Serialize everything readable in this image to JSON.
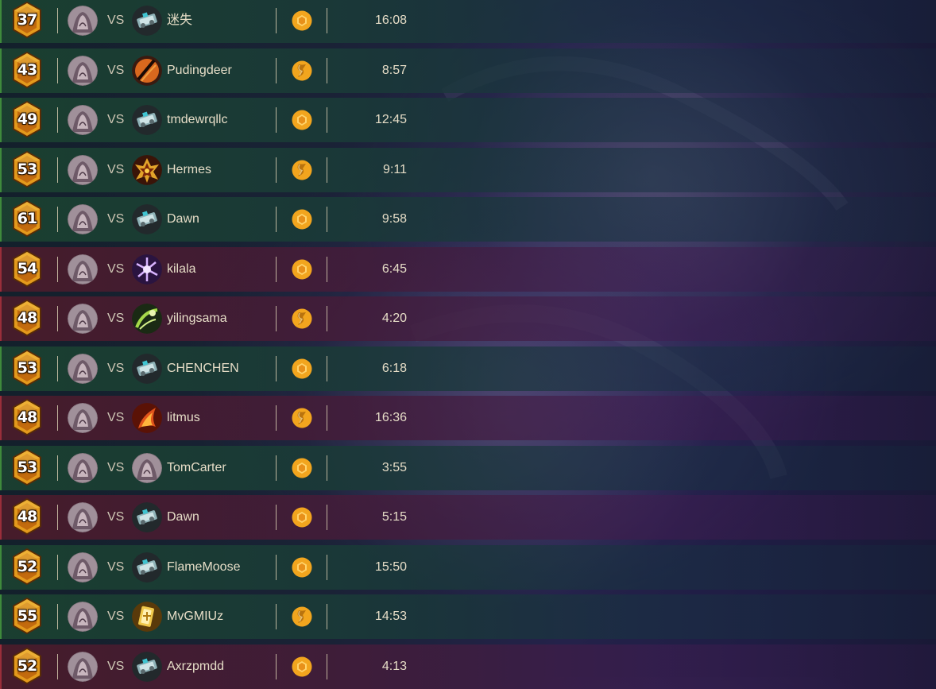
{
  "matches": [
    {
      "result": "win",
      "rank": "37",
      "opponent": "迷失",
      "opponent_hero": "mech-hero",
      "mode": "standard",
      "duration": "16:08"
    },
    {
      "result": "win",
      "rank": "43",
      "opponent": "Pudingdeer",
      "opponent_hero": "rogue-hero",
      "mode": "wild",
      "duration": "8:57"
    },
    {
      "result": "win",
      "rank": "49",
      "opponent": "tmdewrqllc",
      "opponent_hero": "mech-hero",
      "mode": "standard",
      "duration": "12:45"
    },
    {
      "result": "win",
      "rank": "53",
      "opponent": "Hermes",
      "opponent_hero": "warlock-hero",
      "mode": "wild",
      "duration": "9:11"
    },
    {
      "result": "win",
      "rank": "61",
      "opponent": "Dawn",
      "opponent_hero": "mech-hero",
      "mode": "standard",
      "duration": "9:58"
    },
    {
      "result": "loss",
      "rank": "54",
      "opponent": "kilala",
      "opponent_hero": "mage-hero",
      "mode": "standard",
      "duration": "6:45"
    },
    {
      "result": "loss",
      "rank": "48",
      "opponent": "yilingsama",
      "opponent_hero": "hunter-hero",
      "mode": "wild",
      "duration": "4:20"
    },
    {
      "result": "win",
      "rank": "53",
      "opponent": "CHENCHEN",
      "opponent_hero": "mech-hero",
      "mode": "standard",
      "duration": "6:18"
    },
    {
      "result": "loss",
      "rank": "48",
      "opponent": "litmus",
      "opponent_hero": "fire-hero",
      "mode": "wild",
      "duration": "16:36"
    },
    {
      "result": "win",
      "rank": "53",
      "opponent": "TomCarter",
      "opponent_hero": "same-hero",
      "mode": "standard",
      "duration": "3:55"
    },
    {
      "result": "loss",
      "rank": "48",
      "opponent": "Dawn",
      "opponent_hero": "mech-hero",
      "mode": "standard",
      "duration": "5:15"
    },
    {
      "result": "win",
      "rank": "52",
      "opponent": "FlameMoose",
      "opponent_hero": "mech-hero",
      "mode": "standard",
      "duration": "15:50"
    },
    {
      "result": "win",
      "rank": "55",
      "opponent": "MvGMIUz",
      "opponent_hero": "paladin-hero",
      "mode": "wild",
      "duration": "14:53"
    },
    {
      "result": "loss",
      "rank": "52",
      "opponent": "Axrzpmdd",
      "opponent_hero": "mech-hero",
      "mode": "standard",
      "duration": "4:13"
    }
  ],
  "labels": {
    "vs": "VS"
  },
  "colors": {
    "win_stripe": "#3f8a3c",
    "loss_stripe": "#9a2e3a",
    "rank_gold": "#e39a1c",
    "mode_gold": "#f2a51e"
  }
}
